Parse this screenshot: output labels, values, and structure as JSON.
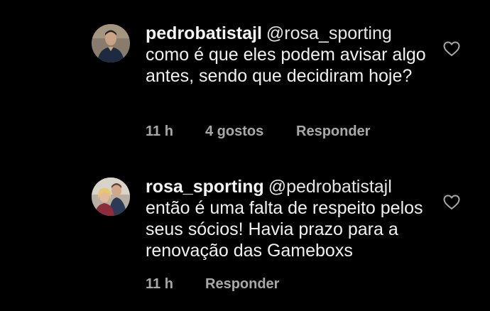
{
  "comments": [
    {
      "username": "pedrobatistajl",
      "mention": "@rosa_sporting",
      "text": "como é que eles podem avisar algo antes, sendo que decidiram hoje?",
      "time": "11 h",
      "likes": "4 gostos",
      "reply_label": "Responder",
      "avatar_icon": "profile-photo-man",
      "like_icon": "heart-outline-icon"
    },
    {
      "username": "rosa_sporting",
      "mention": "@pedrobatistajl",
      "text": "então é uma falta de respeito pelos seus sócios! Havia prazo para a renovação das Gameboxs",
      "time": "11 h",
      "reply_label": "Responder",
      "avatar_icon": "profile-photo-couple",
      "like_icon": "heart-outline-icon"
    }
  ],
  "colors": {
    "background": "#000000",
    "text": "#f5f5f5",
    "meta": "#a8a8a8"
  }
}
